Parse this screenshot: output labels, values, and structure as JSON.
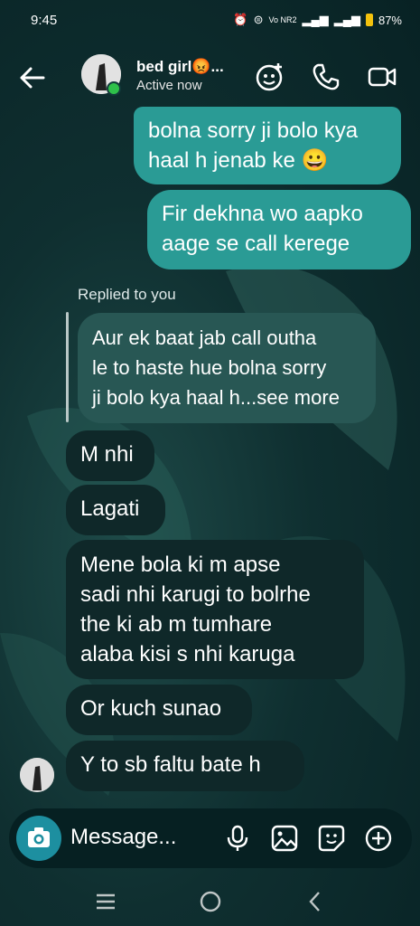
{
  "status_bar": {
    "time": "9:45",
    "network": "Vo NR2",
    "battery": "87%"
  },
  "header": {
    "contact_name": "bed girl😡...",
    "status": "Active now"
  },
  "messages": [
    {
      "side": "out",
      "text_line1": "bolna sorry ji bolo kya",
      "text_line2": "haal h jenab ke 😀"
    },
    {
      "side": "out",
      "text_line1": "Fir dekhna wo aapko",
      "text_line2": "aage se call kerege"
    },
    {
      "side": "in",
      "text": "M nhi"
    },
    {
      "side": "in",
      "text": "Lagati"
    },
    {
      "side": "in",
      "text_line1": "Mene bola ki m apse",
      "text_line2": "sadi nhi karugi to bolrhe",
      "text_line3": "the ki ab m tumhare",
      "text_line4": "alaba kisi s nhi karuga"
    },
    {
      "side": "in",
      "text": "Or kuch sunao"
    },
    {
      "side": "in",
      "text": "Y to sb faltu bate h"
    }
  ],
  "reply": {
    "label": "Replied to you",
    "line1": "Aur ek baat jab call outha",
    "line2": "le to haste hue bolna sorry",
    "line3": "ji bolo kya haal h...see more"
  },
  "composer": {
    "placeholder": "Message..."
  },
  "colors": {
    "outgoing_bubble": "#2a9b95",
    "incoming_bubble": "#0f2829",
    "camera_button": "#1d8fa0",
    "online_dot": "#2ec14a"
  }
}
